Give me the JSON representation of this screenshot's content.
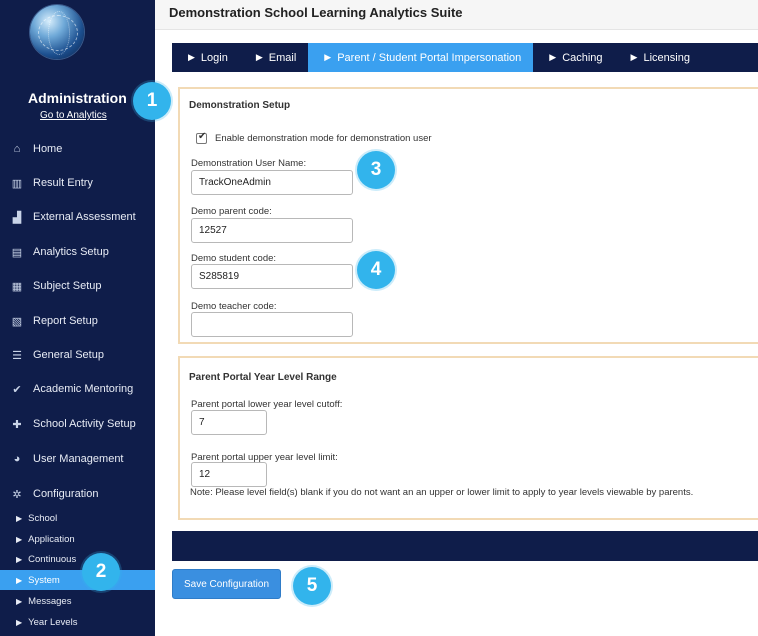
{
  "app": {
    "title": "Demonstration School Learning Analytics Suite"
  },
  "sidebar": {
    "logo": "globe-logo",
    "heading": "Administration",
    "analytics_link": "Go to Analytics",
    "items": [
      {
        "label": "Home",
        "icon": "home-icon",
        "glyph": "⌂"
      },
      {
        "label": "Result Entry",
        "icon": "book-icon",
        "glyph": "▥"
      },
      {
        "label": "External Assessment",
        "icon": "bar-chart-icon",
        "glyph": "▟"
      },
      {
        "label": "Analytics Setup",
        "icon": "line-chart-icon",
        "glyph": "▤"
      },
      {
        "label": "Subject Setup",
        "icon": "books-icon",
        "glyph": "▦"
      },
      {
        "label": "Report Setup",
        "icon": "report-icon",
        "glyph": "▧"
      },
      {
        "label": "General Setup",
        "icon": "list-icon",
        "glyph": "☰"
      },
      {
        "label": "Academic Mentoring",
        "icon": "check-circle-icon",
        "glyph": "✔"
      },
      {
        "label": "School Activity Setup",
        "icon": "puzzle-icon",
        "glyph": "✚"
      },
      {
        "label": "User Management",
        "icon": "users-icon",
        "glyph": "◕"
      },
      {
        "label": "Configuration",
        "icon": "gear-icon",
        "glyph": "✲"
      }
    ],
    "sub_items": [
      {
        "label": "School",
        "active": false
      },
      {
        "label": "Application",
        "active": false
      },
      {
        "label": "Continuous",
        "active": false
      },
      {
        "label": "System",
        "active": true
      },
      {
        "label": "Messages",
        "active": false
      },
      {
        "label": "Year Levels",
        "active": false
      }
    ]
  },
  "tabs": [
    {
      "label": "Login",
      "active": false
    },
    {
      "label": "Email",
      "active": false
    },
    {
      "label": "Parent / Student Portal Impersonation",
      "active": true
    },
    {
      "label": "Caching",
      "active": false
    },
    {
      "label": "Licensing",
      "active": false
    }
  ],
  "demo_setup": {
    "title": "Demonstration Setup",
    "checkbox_label": "Enable demonstration mode for demonstration user",
    "checkbox_checked": true,
    "user_name_label": "Demonstration User Name:",
    "user_name_value": "TrackOneAdmin",
    "parent_code_label": "Demo parent code:",
    "parent_code_value": "12527",
    "student_code_label": "Demo student code:",
    "student_code_value": "S285819",
    "teacher_code_label": "Demo teacher code:",
    "teacher_code_value": ""
  },
  "year_range": {
    "title": "Parent Portal Year Level Range",
    "lower_label": "Parent portal lower year level cutoff:",
    "lower_value": "7",
    "upper_label": "Parent portal upper year level limit:",
    "upper_value": "12",
    "note": "Note: Please level field(s) blank if you do not want an an upper or lower limit to apply to year levels viewable by parents."
  },
  "actions": {
    "save_label": "Save Configuration"
  },
  "callouts": [
    "1",
    "2",
    "3",
    "4",
    "5"
  ],
  "colors": {
    "navy": "#0f1d4a",
    "accent": "#3aa0f0",
    "callout": "#32b4ec",
    "panel_border": "#f2dab5"
  }
}
